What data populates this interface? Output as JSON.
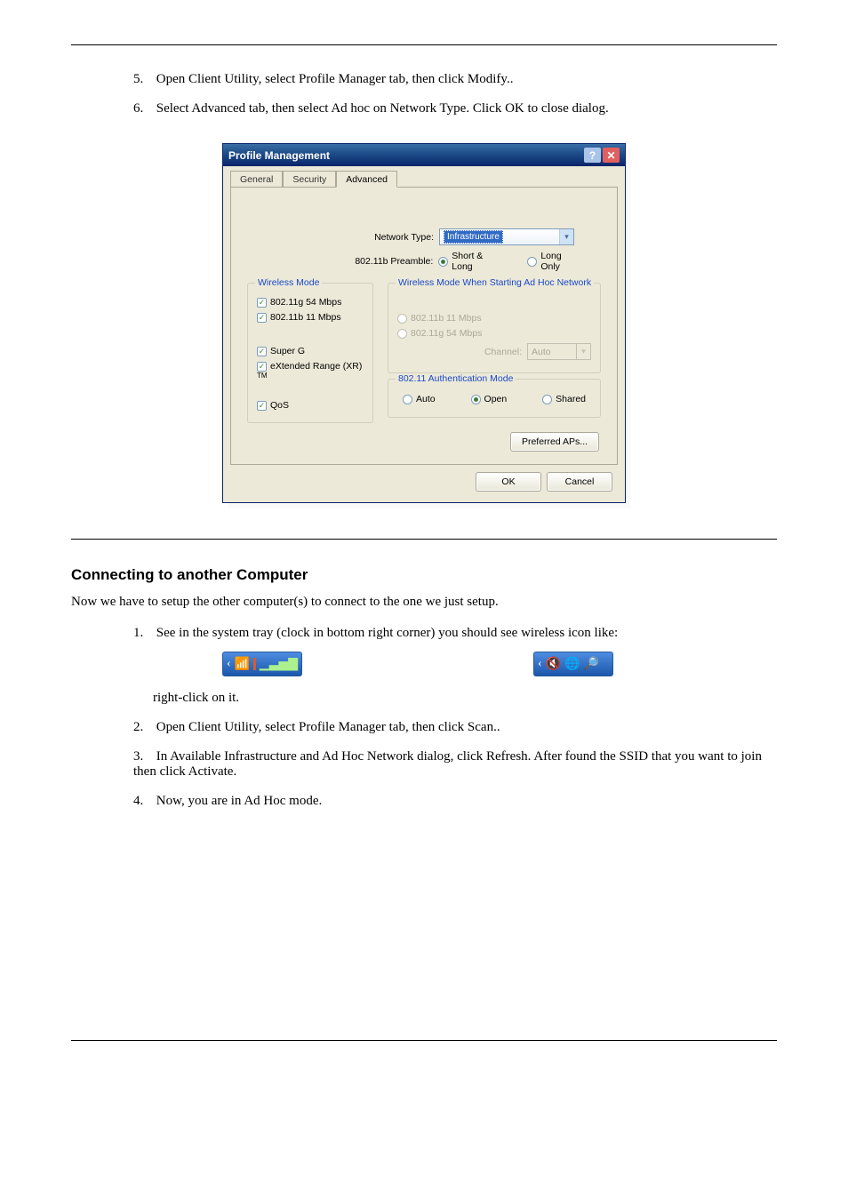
{
  "page": {
    "hr_top_caption": "",
    "step5": {
      "num": "5.",
      "text": "Open Client Utility, select Profile Manager tab, then click Modify.."
    },
    "step6": {
      "num": "6.",
      "text": "Select Advanced tab, then select Ad hoc on Network Type. Click OK to close dialog."
    }
  },
  "dialog": {
    "title": "Profile Management",
    "help_glyph": "?",
    "close_glyph": "✕",
    "tabs": {
      "general": "General",
      "security": "Security",
      "advanced": "Advanced"
    },
    "network_type_label": "Network Type:",
    "network_type_value": "Infrastructure",
    "preamble_label": "802.11b Preamble:",
    "preamble_short": "Short & Long",
    "preamble_long": "Long Only",
    "wireless_mode_legend": "Wireless Mode",
    "wm_items": {
      "g54": "802.11g 54 Mbps",
      "b11": "802.11b 11 Mbps",
      "superg": "Super G",
      "xr_prefix": "eXtended Range (XR)",
      "xr_tm": "TM",
      "qos": "QoS"
    },
    "adhoc_legend": "Wireless Mode When Starting Ad Hoc Network",
    "adhoc_b11": "802.11b 11 Mbps",
    "adhoc_g54": "802.11g 54 Mbps",
    "channel_label": "Channel:",
    "channel_value": "Auto",
    "auth_legend": "802.11 Authentication Mode",
    "auth_auto": "Auto",
    "auth_open": "Open",
    "auth_shared": "Shared",
    "preferred_aps": "Preferred APs...",
    "ok": "OK",
    "cancel": "Cancel"
  },
  "section2": {
    "heading": "Connecting to another Computer",
    "intro": "Now we have to setup the other computer(s) to connect to the one we just setup.",
    "step1": {
      "num": "1.",
      "text1": "See in the system tray (clock in bottom right corner) you should see wireless icon like:",
      "text2": "right-click on it."
    },
    "tray_left_glyphs": "‹  📶",
    "tray_right_glyphs": "‹ 🔇🔎",
    "step2": {
      "num": "2.",
      "text": "Open Client Utility, select Profile Manager tab, then click Scan.."
    },
    "step3": {
      "num": "3.",
      "text": "In Available Infrastructure and Ad Hoc Network dialog, click Refresh. After found the SSID that you want to join then click Activate."
    },
    "step4": {
      "num": "4.",
      "text": "Now, you are in Ad Hoc mode."
    }
  }
}
